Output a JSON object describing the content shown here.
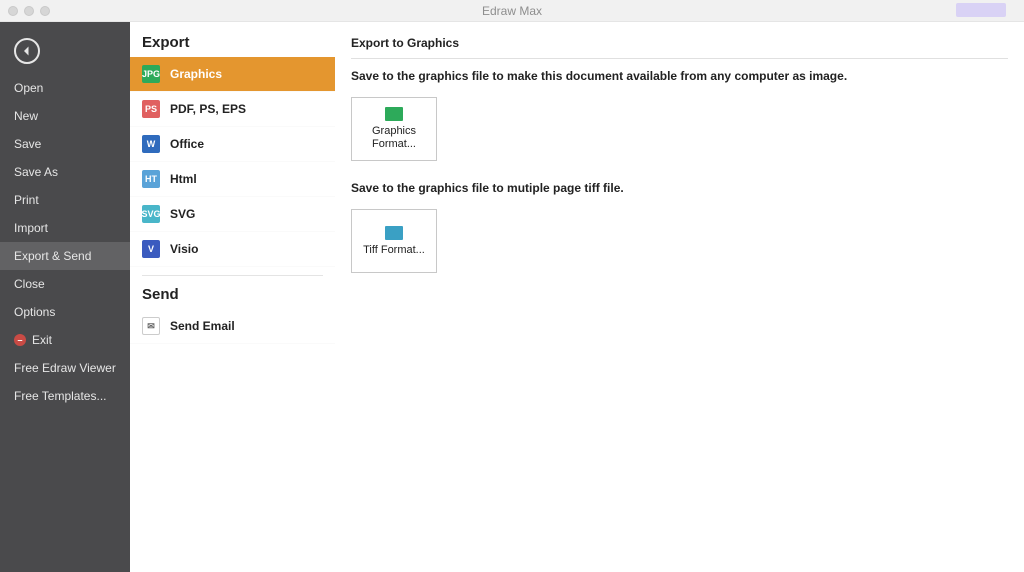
{
  "titlebar": {
    "title": "Edraw Max"
  },
  "sidebar": {
    "items": [
      {
        "label": "Open"
      },
      {
        "label": "New"
      },
      {
        "label": "Save"
      },
      {
        "label": "Save As"
      },
      {
        "label": "Print"
      },
      {
        "label": "Import"
      },
      {
        "label": "Export & Send"
      },
      {
        "label": "Close"
      },
      {
        "label": "Options"
      },
      {
        "label": "Exit"
      },
      {
        "label": "Free Edraw Viewer"
      },
      {
        "label": "Free Templates..."
      }
    ]
  },
  "midcol": {
    "export_title": "Export",
    "send_title": "Send",
    "options": [
      {
        "label": "Graphics"
      },
      {
        "label": "PDF, PS, EPS"
      },
      {
        "label": "Office"
      },
      {
        "label": "Html"
      },
      {
        "label": "SVG"
      },
      {
        "label": "Visio"
      }
    ],
    "send_options": [
      {
        "label": "Send Email"
      }
    ]
  },
  "content": {
    "title": "Export to Graphics",
    "desc1": "Save to the graphics file to make this document available from any computer as image.",
    "card1": "Graphics Format...",
    "desc2": "Save to the graphics file to mutiple page tiff file.",
    "card2": "Tiff Format..."
  }
}
